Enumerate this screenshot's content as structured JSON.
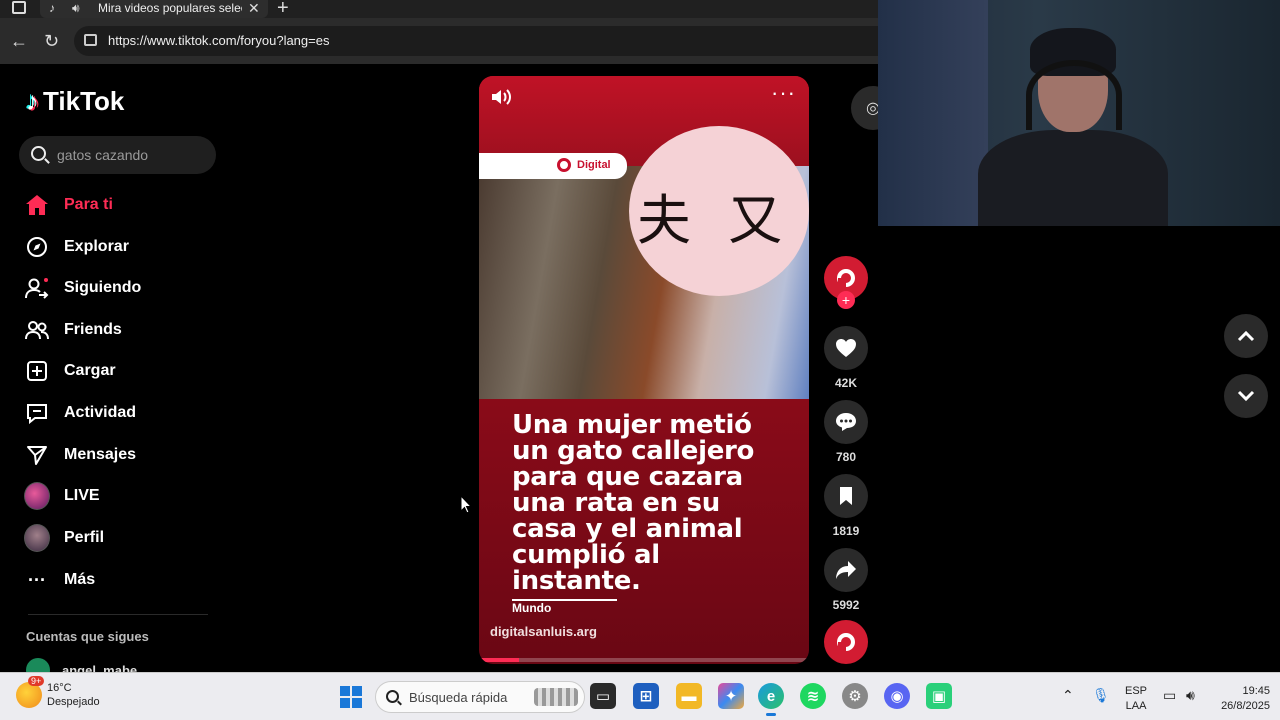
{
  "browser": {
    "tab_title": "Mira videos populares selecc",
    "tab_close": "✕",
    "new_tab": "+",
    "url": "https://www.tiktok.com/foryou?lang=es"
  },
  "sidebar": {
    "logo": "TikTok",
    "search_placeholder": "gatos cazando",
    "items": [
      {
        "label": "Para ti",
        "icon": "home-icon"
      },
      {
        "label": "Explorar",
        "icon": "compass-icon"
      },
      {
        "label": "Siguiendo",
        "icon": "following-icon"
      },
      {
        "label": "Friends",
        "icon": "friends-icon"
      },
      {
        "label": "Cargar",
        "icon": "upload-icon"
      },
      {
        "label": "Actividad",
        "icon": "activity-icon"
      },
      {
        "label": "Mensajes",
        "icon": "messages-icon"
      },
      {
        "label": "LIVE",
        "icon": "live-avatar"
      },
      {
        "label": "Perfil",
        "icon": "profile-avatar"
      },
      {
        "label": "Más",
        "icon": "more-icon"
      }
    ],
    "following_title": "Cuentas que sigues",
    "following": [
      {
        "name": "angel_mabe"
      }
    ],
    "accent": "#fe2c55"
  },
  "video": {
    "brand": "Digital",
    "kanji": "夫 又",
    "headline": "Una mujer metió un gato callejero para que cazara una rata en su casa y el animal cumplió al instante.",
    "section": "Mundo",
    "site": "digitalsanluis.arg",
    "progress": 0.12
  },
  "actions": {
    "likes": "42K",
    "comments": "780",
    "saves": "1819",
    "shares": "5992"
  },
  "taskbar": {
    "temp": "16°C",
    "weather": "Despejado",
    "weather_badge": "9+",
    "search_placeholder": "Búsqueda rápida",
    "lang_top": "ESP",
    "lang_bottom": "LAA",
    "time": "19:45",
    "date": "26/8/2025"
  }
}
